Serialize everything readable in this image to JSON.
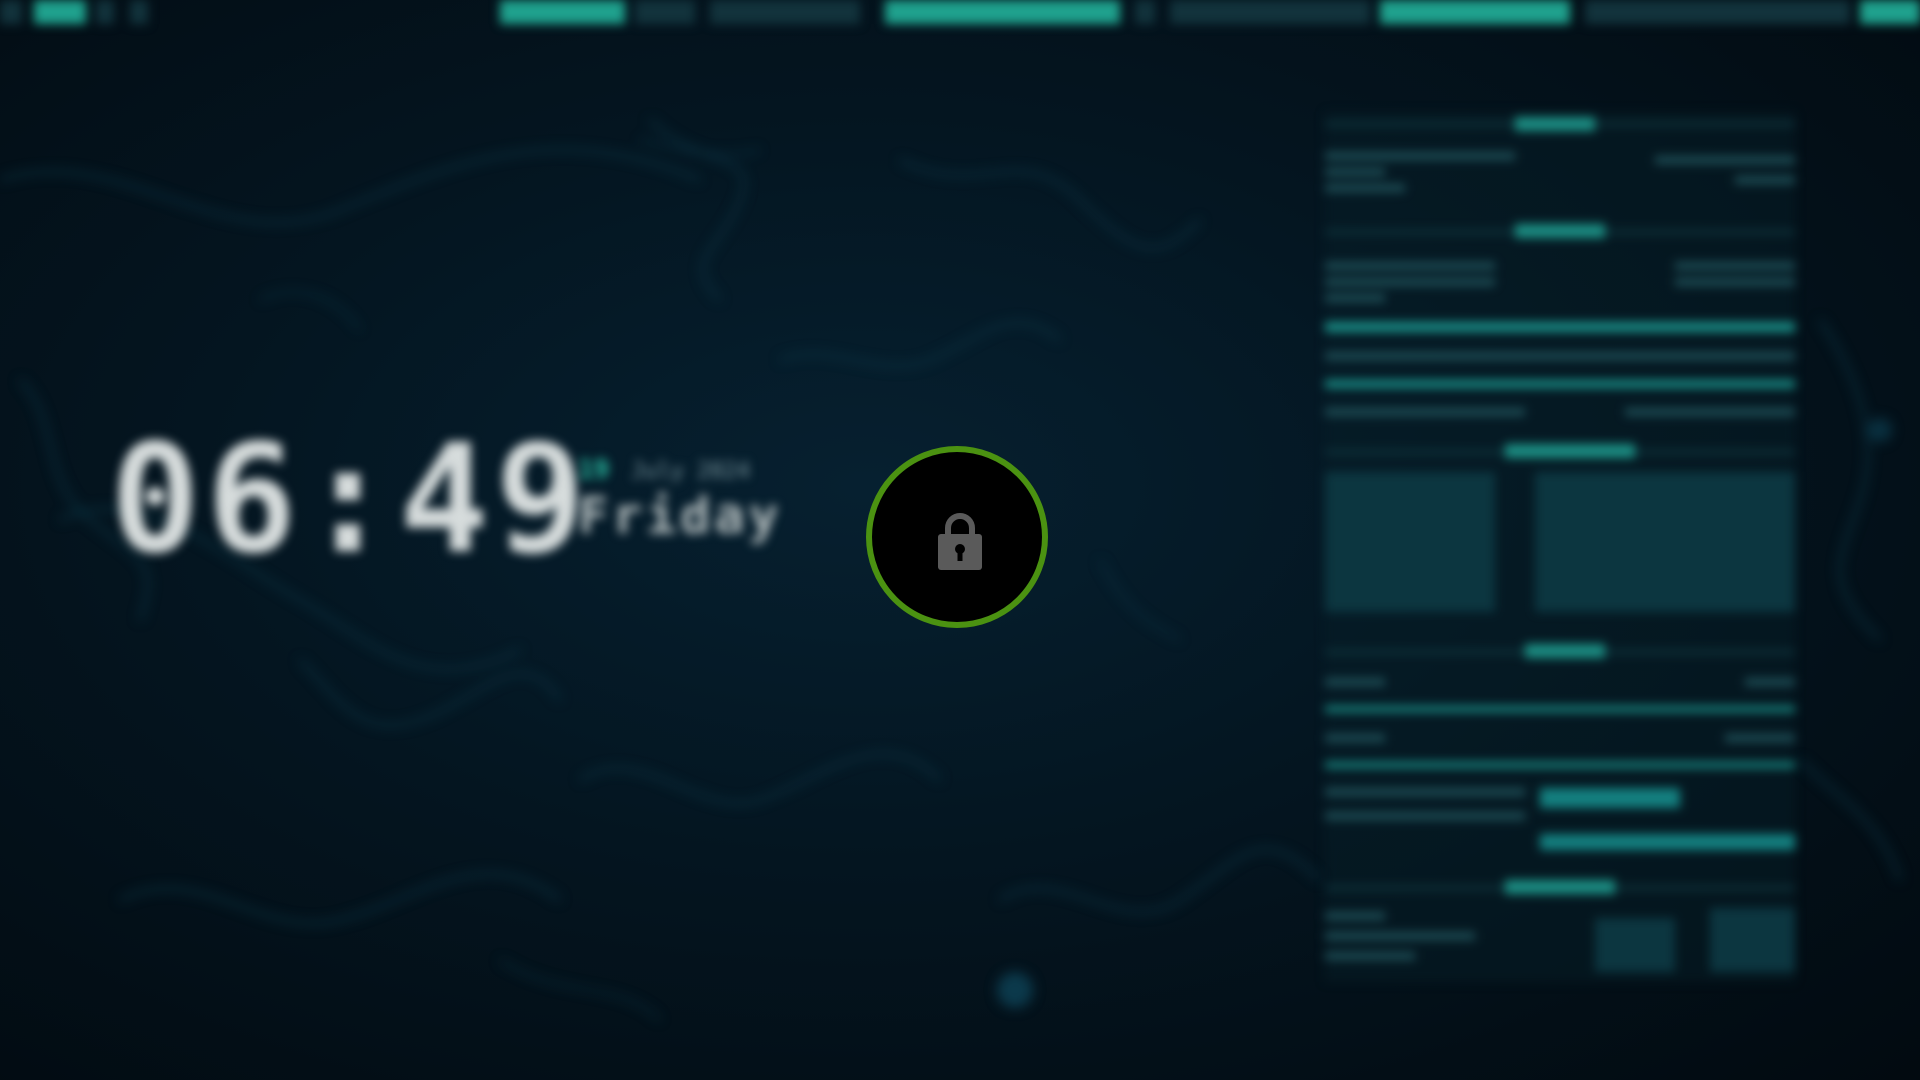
{
  "lockscreen": {
    "clock": {
      "time": "06:49",
      "badge": "19",
      "month": "July 2024",
      "day": "Friday"
    },
    "lock_indicator": {
      "icon": "lock-icon",
      "ring_color": "#4b9211"
    }
  },
  "colors": {
    "accent": "#1fa28e",
    "background": "#030c12",
    "clock_text": "#d6dcdc"
  }
}
